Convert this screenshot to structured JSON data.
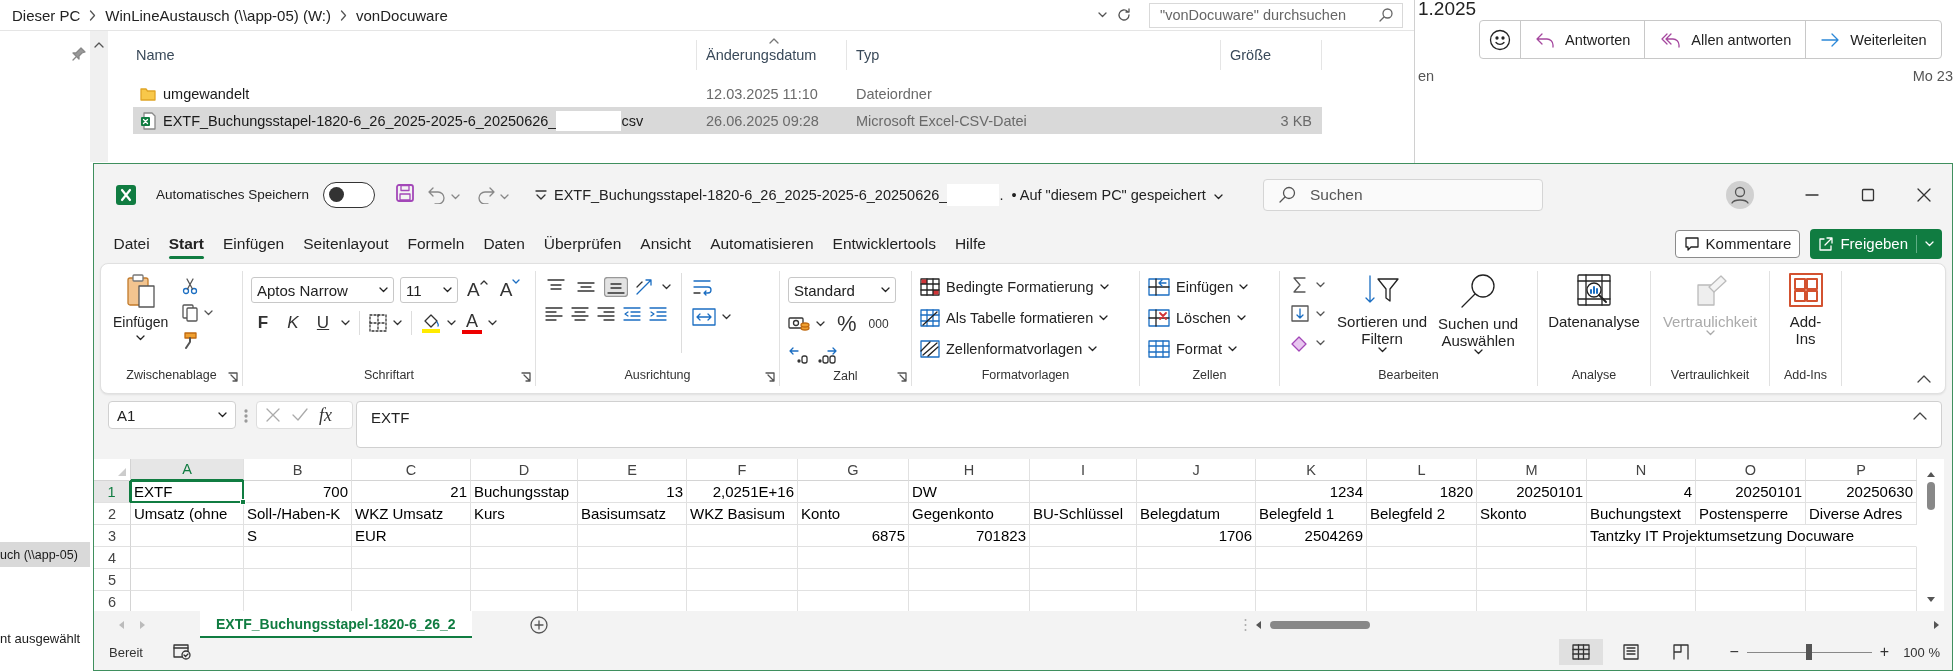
{
  "explorer": {
    "breadcrumb": [
      "Dieser PC",
      "WinLineAustausch (\\\\app-05) (W:)",
      "vonDocuware"
    ],
    "search": {
      "placeholder": "\"vonDocuware\" durchsuchen"
    },
    "columns": [
      {
        "label": "Name",
        "sorted": false
      },
      {
        "label": "Änderungsdatum",
        "sorted": true
      },
      {
        "label": "Typ",
        "sorted": false
      },
      {
        "label": "Größe",
        "sorted": false
      }
    ],
    "files": [
      {
        "kind": "folder",
        "name": "umgewandelt",
        "modified": "12.03.2025 11:10",
        "type": "Dateiordner",
        "selected": false
      },
      {
        "kind": "excel",
        "name": "EXTF_Buchungsstapel-1820-6_26_2025-2025-6_20250626_",
        "redacted": true,
        "extension": "csv",
        "modified": "26.06.2025 09:28",
        "type": "Microsoft Excel-CSV-Datei",
        "size": "3 KB",
        "selected": true
      }
    ],
    "nav_items": [
      {
        "label": "uch (\\\\app-05)",
        "selected": true
      }
    ],
    "status": "nt ausgewählt"
  },
  "mail": {
    "subject_fragment": "1.2025",
    "actions": [
      {
        "kind": "emoji"
      },
      {
        "kind": "reply",
        "label": "Antworten"
      },
      {
        "kind": "reply_all",
        "label": "Allen antworten"
      },
      {
        "kind": "forward",
        "label": "Weiterleiten"
      }
    ],
    "sender_fragment": "en",
    "date": "Mo 23"
  },
  "excel": {
    "autosave": {
      "label": "Automatisches Speichern",
      "on": false
    },
    "title": {
      "name": "EXTF_Buchungsstapel-1820-6_26_2025-2025-6_20250626_",
      "redacted": true,
      "name_end": ".",
      "location": "• Auf \"diesem PC\" gespeichert"
    },
    "search": {
      "placeholder": "Suchen"
    },
    "tabs": [
      {
        "label": "Datei",
        "selected": false
      },
      {
        "label": "Start",
        "selected": true
      },
      {
        "label": "Einfügen",
        "selected": false
      },
      {
        "label": "Seitenlayout",
        "selected": false
      },
      {
        "label": "Formeln",
        "selected": false
      },
      {
        "label": "Daten",
        "selected": false
      },
      {
        "label": "Überprüfen",
        "selected": false
      },
      {
        "label": "Ansicht",
        "selected": false
      },
      {
        "label": "Automatisieren",
        "selected": false
      },
      {
        "label": "Entwicklertools",
        "selected": false
      },
      {
        "label": "Hilfe",
        "selected": false
      }
    ],
    "comments": "Kommentare",
    "share": "Freigeben",
    "ribbon": [
      {
        "kind": "clipboard",
        "label": "Zwischenablage",
        "launcher": true,
        "paste": "Einfügen"
      },
      {
        "kind": "font",
        "label": "Schriftart",
        "launcher": true,
        "font": "Aptos Narrow",
        "size": "11",
        "grow": "A",
        "shrink": "A",
        "styles": [
          {
            "kind": "bold",
            "label": "F"
          },
          {
            "kind": "italic",
            "label": "K"
          },
          {
            "kind": "underline",
            "label": "U"
          }
        ],
        "font_color": "A"
      },
      {
        "kind": "alignment",
        "label": "Ausrichtung",
        "launcher": true,
        "vertical": [
          {
            "kind": "top",
            "selected": false
          },
          {
            "kind": "middle",
            "selected": false
          },
          {
            "kind": "bottom",
            "selected": true
          }
        ]
      },
      {
        "kind": "number",
        "label": "Zahl",
        "launcher": true,
        "format": "Standard",
        "percent": "%",
        "thousands": "000"
      },
      {
        "kind": "list",
        "label": "Formatvorlagen",
        "launcher": false,
        "items": [
          {
            "kind": "conditional",
            "label": "Bedingte Formatierung"
          },
          {
            "kind": "table",
            "label": "Als Tabelle formatieren"
          },
          {
            "kind": "cellstyles",
            "label": "Zellenformatvorlagen"
          }
        ]
      },
      {
        "kind": "list",
        "label": "Zellen",
        "launcher": false,
        "items": [
          {
            "kind": "insert",
            "label": "Einfügen"
          },
          {
            "kind": "delete",
            "label": "Löschen"
          },
          {
            "kind": "format",
            "label": "Format"
          }
        ]
      },
      {
        "kind": "editing",
        "label": "Bearbeiten",
        "launcher": false,
        "items": [
          {
            "kind": "sort",
            "label": "Sortieren und Filtern"
          },
          {
            "kind": "find",
            "label": "Suchen und Auswählen"
          }
        ]
      },
      {
        "kind": "big",
        "label": "Analyse",
        "launcher": false,
        "items": [
          {
            "kind": "analysis",
            "label": "Datenanalyse",
            "disabled": false,
            "menu": false
          }
        ]
      },
      {
        "kind": "big",
        "label": "Vertraulichkeit",
        "launcher": false,
        "items": [
          {
            "kind": "sensitivity",
            "label": "Vertraulichkeit",
            "disabled": true,
            "menu": true
          }
        ]
      },
      {
        "kind": "big",
        "label": "Add-Ins",
        "launcher": false,
        "items": [
          {
            "kind": "addins",
            "label": "Add-Ins",
            "disabled": false,
            "menu": false
          }
        ]
      }
    ],
    "formula_bar": {
      "name_box": "A1",
      "fx": "fx",
      "formula": "EXTF"
    },
    "sheet": {
      "columns": [
        {
          "label": "A",
          "selected": true
        },
        {
          "label": "B",
          "selected": false
        },
        {
          "label": "C",
          "selected": false
        },
        {
          "label": "D",
          "selected": false
        },
        {
          "label": "E",
          "selected": false
        },
        {
          "label": "F",
          "selected": false
        },
        {
          "label": "G",
          "selected": false
        },
        {
          "label": "H",
          "selected": false
        },
        {
          "label": "I",
          "selected": false
        },
        {
          "label": "J",
          "selected": false
        },
        {
          "label": "K",
          "selected": false
        },
        {
          "label": "L",
          "selected": false
        },
        {
          "label": "M",
          "selected": false
        },
        {
          "label": "N",
          "selected": false
        },
        {
          "label": "O",
          "selected": false
        },
        {
          "label": "P",
          "selected": false
        }
      ],
      "rows": [
        {
          "number": "1",
          "selected": true,
          "cells": [
            {
              "kind": "text",
              "text": "EXTF"
            },
            {
              "kind": "number",
              "text": "700"
            },
            {
              "kind": "number",
              "text": "21"
            },
            {
              "kind": "text",
              "text": "Buchungsstap"
            },
            {
              "kind": "number",
              "text": "13"
            },
            {
              "kind": "number",
              "text": "2,0251E+16"
            },
            {
              "kind": "empty"
            },
            {
              "kind": "text",
              "text": "DW"
            },
            {
              "kind": "empty"
            },
            {
              "kind": "empty"
            },
            {
              "kind": "number",
              "text": "1234"
            },
            {
              "kind": "number",
              "text": "1820"
            },
            {
              "kind": "number",
              "text": "20250101"
            },
            {
              "kind": "number",
              "text": "4"
            },
            {
              "kind": "number",
              "text": "20250101"
            },
            {
              "kind": "number",
              "text": "20250630"
            }
          ]
        },
        {
          "number": "2",
          "selected": false,
          "cells": [
            {
              "kind": "text",
              "text": "Umsatz (ohne"
            },
            {
              "kind": "text",
              "text": "Soll-/Haben-K"
            },
            {
              "kind": "text",
              "text": "WKZ Umsatz"
            },
            {
              "kind": "text",
              "text": "Kurs"
            },
            {
              "kind": "text",
              "text": "Basisumsatz"
            },
            {
              "kind": "text",
              "text": "WKZ Basisum"
            },
            {
              "kind": "text",
              "text": "Konto"
            },
            {
              "kind": "text",
              "text": "Gegenkonto"
            },
            {
              "kind": "text",
              "text": "BU-Schlüssel"
            },
            {
              "kind": "text",
              "text": "Belegdatum"
            },
            {
              "kind": "text",
              "text": "Belegfeld 1"
            },
            {
              "kind": "text",
              "text": "Belegfeld 2"
            },
            {
              "kind": "text",
              "text": "Skonto"
            },
            {
              "kind": "text",
              "text": "Buchungstext"
            },
            {
              "kind": "text",
              "text": "Postensperre"
            },
            {
              "kind": "text",
              "text": "Diverse Adres"
            }
          ]
        },
        {
          "number": "3",
          "selected": false,
          "cells": [
            {
              "kind": "empty"
            },
            {
              "kind": "text",
              "text": "S"
            },
            {
              "kind": "text",
              "text": "EUR"
            },
            {
              "kind": "empty"
            },
            {
              "kind": "empty"
            },
            {
              "kind": "empty"
            },
            {
              "kind": "number",
              "text": "6875"
            },
            {
              "kind": "number",
              "text": "701823"
            },
            {
              "kind": "empty"
            },
            {
              "kind": "number",
              "text": "1706"
            },
            {
              "kind": "number",
              "text": "2504269"
            },
            {
              "kind": "empty"
            },
            {
              "kind": "empty"
            },
            {
              "kind": "text",
              "text": "Tantzky IT Projektumsetzung Docuware"
            },
            {
              "kind": "empty"
            },
            {
              "kind": "empty"
            }
          ]
        },
        {
          "number": "4",
          "selected": false
        },
        {
          "number": "5",
          "selected": false
        },
        {
          "number": "6",
          "selected": false
        }
      ]
    },
    "sheet_tabs": [
      {
        "label": "EXTF_Buchungsstapel-1820-6_26_2",
        "selected": true
      }
    ],
    "status": {
      "text": "Bereit",
      "views": [
        {
          "kind": "normal",
          "selected": true
        },
        {
          "kind": "layout",
          "selected": false
        },
        {
          "kind": "pagebreak",
          "selected": false
        }
      ],
      "zoom": {
        "minus": "−",
        "plus": "+",
        "level": 0.5,
        "reading": "100 %"
      }
    }
  }
}
